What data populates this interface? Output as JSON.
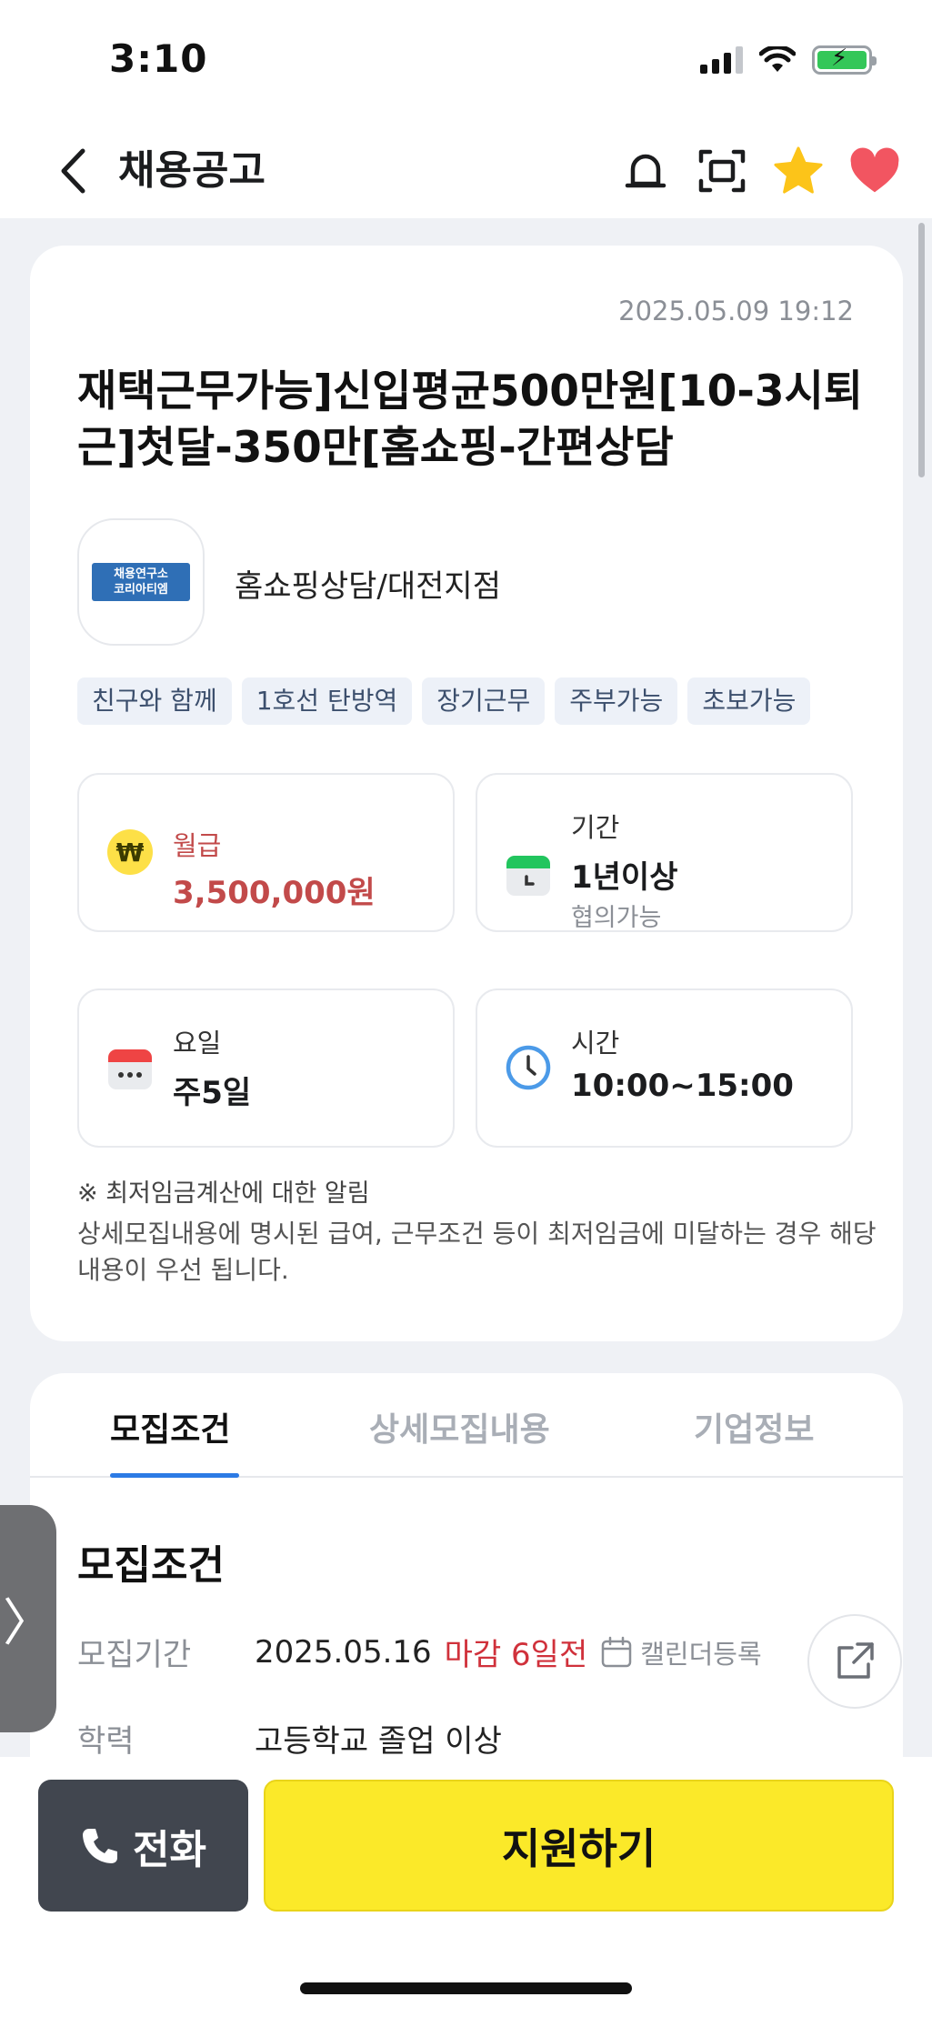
{
  "status_bar": {
    "time": "3:10"
  },
  "header": {
    "title": "채용공고",
    "icons": [
      "back-chevron-icon",
      "bell-icon",
      "scan-icon",
      "star-icon",
      "heart-icon"
    ],
    "accent_colors": {
      "star": "#fcc419",
      "heart": "#f25561"
    }
  },
  "job": {
    "posted_at": "2025.05.09 19:12",
    "title": "재택근무가능]신입평균500만원[10-3시퇴근]첫달-350만[홈쇼핑-간편상담",
    "logo_text_line1": "채용연구소",
    "logo_text_line2": "코리아티엠",
    "company": "홈쇼핑상담/대전지점",
    "tags": [
      "친구와 함께",
      "1호선 탄방역",
      "장기근무",
      "주부가능",
      "초보가능"
    ]
  },
  "info": {
    "pay": {
      "label": "월급",
      "value": "3,500,000원",
      "color": "#c24a4a"
    },
    "period": {
      "label": "기간",
      "value": "1년이상",
      "sub": "협의가능"
    },
    "days": {
      "label": "요일",
      "value": "주5일"
    },
    "hours": {
      "label": "시간",
      "value": "10:00~15:00"
    }
  },
  "notice": {
    "title": "※ 최저임금계산에 대한 알림",
    "body": "상세모집내용에 명시된 급여, 근무조건 등이 최저임금에 미달하는 경우 해당 내용이 우선 됩니다."
  },
  "tabs": [
    {
      "label": "모집조건",
      "active": true
    },
    {
      "label": "상세모집내용",
      "active": false
    },
    {
      "label": "기업정보",
      "active": false
    }
  ],
  "recruit": {
    "section_title": "모집조건",
    "period_label": "모집기간",
    "period_value": "2025.05.16",
    "deadline": "마감 6일전",
    "calendar_register": "캘린더등록",
    "education_label": "학력",
    "education_value": "고등학교 졸업 이상"
  },
  "bottom": {
    "call_label": "전화",
    "apply_label": "지원하기",
    "apply_color": "#fbe929"
  }
}
